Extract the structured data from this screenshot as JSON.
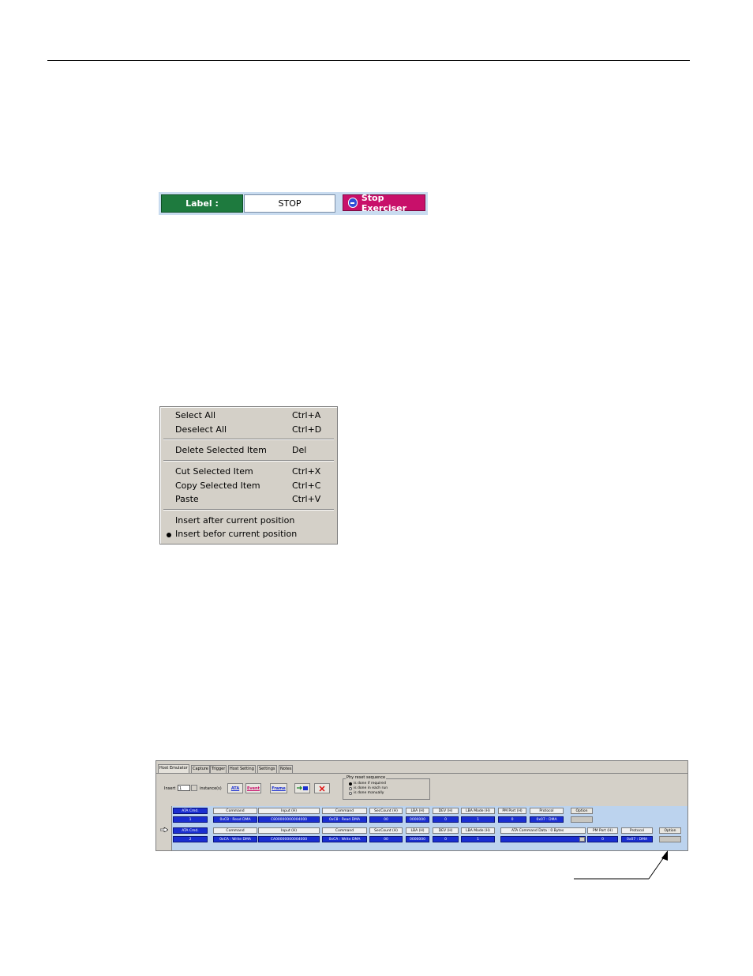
{
  "label_bar": {
    "label_text": "Label :",
    "input_value": "STOP",
    "stop_button": "Stop Exerciser"
  },
  "context_menu": {
    "items": [
      {
        "label": "Select All",
        "shortcut": "Ctrl+A"
      },
      {
        "label": "Deselect All",
        "shortcut": "Ctrl+D"
      },
      {
        "label": "Delete Selected Item",
        "shortcut": "Del"
      },
      {
        "label": "Cut Selected Item",
        "shortcut": "Ctrl+X"
      },
      {
        "label": "Copy Selected Item",
        "shortcut": "Ctrl+C"
      },
      {
        "label": "Paste",
        "shortcut": "Ctrl+V"
      },
      {
        "label": "Insert after current position",
        "shortcut": ""
      },
      {
        "label": "Insert befor current position",
        "shortcut": "",
        "selected": true
      }
    ]
  },
  "host_panel": {
    "tabs": [
      "Host Emulator",
      "Capture",
      "Trigger",
      "Host Setting",
      "Settings",
      "Notes"
    ],
    "insert_label": "Insert",
    "insert_value": "1",
    "instances_label": "instance(s)",
    "toolbar": {
      "ata": "ATA",
      "event": "Event",
      "frame": "Frame"
    },
    "phy_reset": {
      "title": "Phy reset sequence",
      "options": [
        "is done if required",
        "is done in each run",
        "is done manually"
      ],
      "selected_index": 0
    },
    "row1": {
      "name": "ATA Cmd.",
      "index": "1",
      "h_command": "Command",
      "command": "0xC8 : Read DMA",
      "h_input": "Input (H)",
      "input": "C800000000004000",
      "h_command2": "Command",
      "command2": "0xC8 : Read DMA",
      "h_seccount": "SecCount (H)",
      "seccount": "00",
      "h_lba": "LBA (H)",
      "lba": "0000000",
      "h_dev": "DEV (H)",
      "dev": "0",
      "h_lbamode": "LBA Mode (H)",
      "lbamode": "1",
      "h_pmport": "PM Port (H)",
      "pmport": "0",
      "h_protocol": "Protocol",
      "protocol": "0x07 : DMA",
      "option": "Option"
    },
    "row2": {
      "name": "ATA Cmd.",
      "index": "2",
      "h_command": "Command",
      "command": "0xCA : Write DMA",
      "h_input": "Input (H)",
      "input": "CA00000000004000",
      "h_command2": "Command",
      "command2": "0xCA : Write DMA",
      "h_seccount": "SecCount (H)",
      "seccount": "00",
      "h_lba": "LBA (H)",
      "lba": "0000000",
      "h_dev": "DEV (H)",
      "dev": "0",
      "h_lbamode": "LBA Mode (H)",
      "lbamode": "1",
      "h_data": "ATA Command Data : 0 Bytes",
      "h_pmport": "PM Port (H)",
      "pmport": "0",
      "h_protocol": "Protocol",
      "protocol": "0x07 : DMA",
      "option": "Option"
    }
  },
  "colors": {
    "label_green": "#1e7a3e",
    "stop_magenta": "#c8106a",
    "cell_blue": "#1a2ed0",
    "sequence_bg": "#bcd3ee",
    "window_gray": "#d4d0c8"
  }
}
